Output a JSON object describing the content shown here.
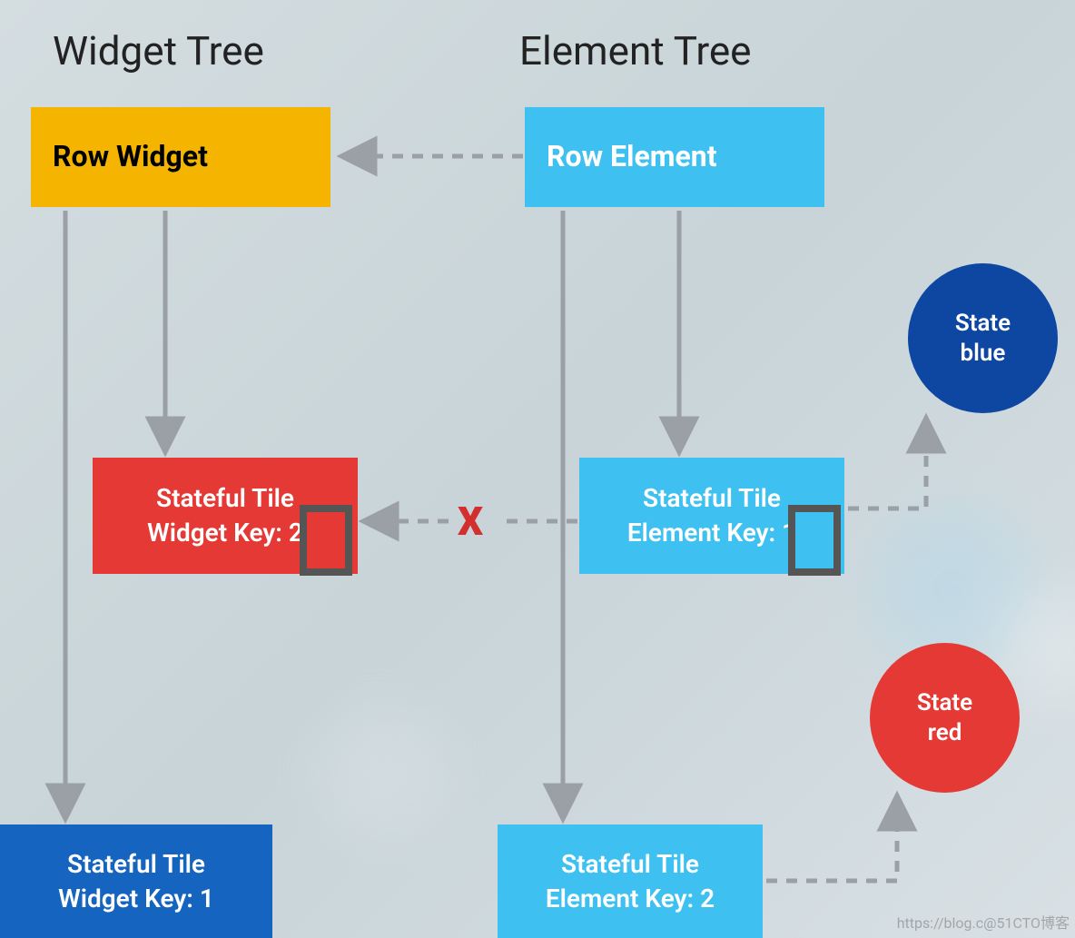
{
  "headings": {
    "widget_tree": "Widget Tree",
    "element_tree": "Element Tree"
  },
  "widget_tree": {
    "row": "Row Widget",
    "tile_mid": {
      "line1": "Stateful Tile",
      "line2": "Widget Key: 2"
    },
    "tile_bot": {
      "line1": "Stateful Tile",
      "line2": "Widget Key: 1"
    }
  },
  "element_tree": {
    "row": "Row Element",
    "tile_mid": {
      "line1": "Stateful Tile",
      "line2": "Element Key: 1"
    },
    "tile_bot": {
      "line1": "Stateful Tile",
      "line2": "Element Key: 2"
    }
  },
  "states": {
    "blue": {
      "line1": "State",
      "line2": "blue"
    },
    "red": {
      "line1": "State",
      "line2": "red"
    }
  },
  "mismatch_mark": "X",
  "watermark": "https://blog.c@51CTO博客",
  "colors": {
    "amber": "#f4b400",
    "light_blue": "#3ec1f0",
    "red": "#e53935",
    "dark_blue": "#1565c0",
    "navy": "#0d47a1",
    "arrow": "#9aa0a6"
  }
}
